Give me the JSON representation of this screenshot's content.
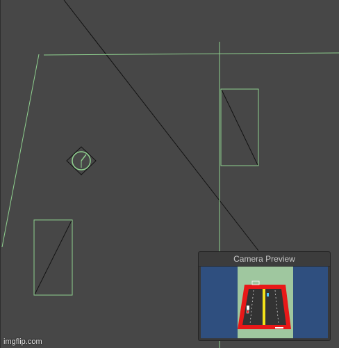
{
  "scene_view": {
    "gizmo_color": "#8fd18f",
    "line_color": "#121212",
    "background": "#474747"
  },
  "camera_preview": {
    "title": "Camera Preview",
    "sky_color": "#2f4f7f",
    "ground_color": "#9fc79f",
    "road_color": "#333333",
    "track_color": "#e81818",
    "center_line_color": "#f2e21a"
  },
  "watermark": {
    "text": "imgflip.com"
  }
}
